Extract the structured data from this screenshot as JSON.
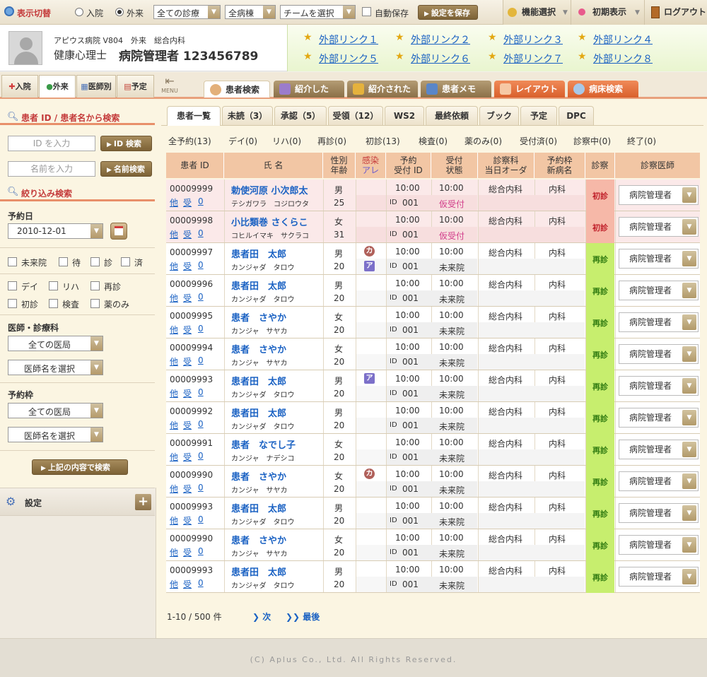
{
  "topbar": {
    "display_switch": "表示切替",
    "radio_inpatient": "入院",
    "radio_outpatient": "外来",
    "select_dept": "全ての診療",
    "select_ward": "全病棟",
    "select_team": "チームを選択",
    "autosave": "自動保存",
    "save_settings": "設定を保存",
    "feature_select": "機能選択",
    "initial_display": "初期表示",
    "logout": "ログアウト"
  },
  "header": {
    "hospital_line": "アピウス病院 V804　外来　総合内科",
    "role": "健康心理士",
    "user": "病院管理者 123456789"
  },
  "links": [
    "外部リンク１",
    "外部リンク２",
    "外部リンク３",
    "外部リンク４",
    "外部リンク５",
    "外部リンク６",
    "外部リンク７",
    "外部リンク８"
  ],
  "left_tabs": [
    "入院",
    "外来",
    "医師別",
    "予定"
  ],
  "menu_label": "MENU",
  "main_tabs": [
    "患者検索",
    "紹介した",
    "紹介された",
    "患者メモ",
    "レイアウト",
    "病床検索"
  ],
  "sidebar": {
    "search_title": "患者 ID / 患者名から検索",
    "id_placeholder": "ID を入力",
    "id_button": "ID 検索",
    "name_placeholder": "名前を入力",
    "name_button": "名前検索",
    "filter_title": "絞り込み検索",
    "date_label": "予約日",
    "date_value": "2010-12-01",
    "check_row1": [
      "未来院",
      "待",
      "診",
      "済"
    ],
    "check_row2": [
      "デイ",
      "リハ",
      "再診"
    ],
    "check_row3": [
      "初診",
      "検査",
      "薬のみ"
    ],
    "doctor_label": "医師・診療科",
    "doctor_dept": "全ての医局",
    "doctor_name": "医師名を選択",
    "slot_label": "予約枠",
    "slot_dept": "全ての医局",
    "slot_name": "医師名を選択",
    "search_button": "上記の内容で検索",
    "settings": "設定"
  },
  "sub_tabs": [
    "患者一覧",
    "未読（3）",
    "承認（5）",
    "受領（12）",
    "WS2",
    "最終依頼",
    "ブック",
    "予定",
    "DPC"
  ],
  "filters": [
    "全予約(13)",
    "デイ(0)",
    "リハ(0)",
    "再診(0)",
    "初診(13)",
    "検査(0)",
    "薬のみ(0)",
    "受付済(0)",
    "診察中(0)",
    "終了(0)"
  ],
  "table": {
    "headers": {
      "id": "患者 ID",
      "name": "氏 名",
      "sex1": "性別",
      "sex2": "年齢",
      "inf1": "感染",
      "inf2": "アレ",
      "res1": "予約",
      "res2": "受付 ID",
      "rec1": "受付",
      "rec2": "状態",
      "dept1": "診察科",
      "dept2": "当日オーダ",
      "slot1": "予約枠",
      "slot2": "新病名",
      "exam": "診察",
      "doctor": "診察医師"
    },
    "rows": [
      {
        "id": "00009999",
        "name": "勅使河原 小次郎太",
        "kana": "テシガワラ　コジロウタ",
        "sex": "男",
        "age": "25",
        "badge": "",
        "time1": "10:00",
        "rid": "001",
        "time2": "10:00",
        "status": "仮受付",
        "dept": "総合内科",
        "slot": "内科",
        "exam": "初診",
        "doctor": "病院管理者",
        "pink": true
      },
      {
        "id": "00009998",
        "name": "小比類巻 さくらこ",
        "kana": "コヒルイマキ　サクラコ",
        "sex": "女",
        "age": "31",
        "badge": "",
        "time1": "10:00",
        "rid": "001",
        "time2": "10:00",
        "status": "仮受付",
        "dept": "総合内科",
        "slot": "内科",
        "exam": "初診",
        "doctor": "病院管理者",
        "pink": true
      },
      {
        "id": "00009997",
        "name": "患者田　太郎",
        "kana": "カンジャダ　タロウ",
        "sex": "男",
        "age": "20",
        "badge": "カア",
        "time1": "10:00",
        "rid": "001",
        "time2": "10:00",
        "status": "未来院",
        "dept": "総合内科",
        "slot": "内科",
        "exam": "再診",
        "doctor": "病院管理者",
        "pink": false
      },
      {
        "id": "00009996",
        "name": "患者田　太郎",
        "kana": "カンジャダ　タロウ",
        "sex": "男",
        "age": "20",
        "badge": "",
        "time1": "10:00",
        "rid": "001",
        "time2": "10:00",
        "status": "未来院",
        "dept": "総合内科",
        "slot": "内科",
        "exam": "再診",
        "doctor": "病院管理者",
        "pink": false
      },
      {
        "id": "00009995",
        "name": "患者　さやか",
        "kana": "カンジャ　サヤカ",
        "sex": "女",
        "age": "20",
        "badge": "",
        "time1": "10:00",
        "rid": "001",
        "time2": "10:00",
        "status": "未来院",
        "dept": "総合内科",
        "slot": "内科",
        "exam": "再診",
        "doctor": "病院管理者",
        "pink": false
      },
      {
        "id": "00009994",
        "name": "患者　さやか",
        "kana": "カンジャ　サヤカ",
        "sex": "女",
        "age": "20",
        "badge": "",
        "time1": "10:00",
        "rid": "001",
        "time2": "10:00",
        "status": "未来院",
        "dept": "総合内科",
        "slot": "内科",
        "exam": "再診",
        "doctor": "病院管理者",
        "pink": false
      },
      {
        "id": "00009993",
        "name": "患者田　太郎",
        "kana": "カンジャダ　タロウ",
        "sex": "男",
        "age": "20",
        "badge": "ア",
        "time1": "10:00",
        "rid": "001",
        "time2": "10:00",
        "status": "未来院",
        "dept": "総合内科",
        "slot": "内科",
        "exam": "再診",
        "doctor": "病院管理者",
        "pink": false
      },
      {
        "id": "00009992",
        "name": "患者田　太郎",
        "kana": "カンジャダ　タロウ",
        "sex": "男",
        "age": "20",
        "badge": "",
        "time1": "10:00",
        "rid": "001",
        "time2": "10:00",
        "status": "未来院",
        "dept": "総合内科",
        "slot": "内科",
        "exam": "再診",
        "doctor": "病院管理者",
        "pink": false
      },
      {
        "id": "00009991",
        "name": "患者　なでし子",
        "kana": "カンジャ　ナデシコ",
        "sex": "女",
        "age": "20",
        "badge": "",
        "time1": "10:00",
        "rid": "001",
        "time2": "10:00",
        "status": "未来院",
        "dept": "総合内科",
        "slot": "内科",
        "exam": "再診",
        "doctor": "病院管理者",
        "pink": false
      },
      {
        "id": "00009990",
        "name": "患者　さやか",
        "kana": "カンジャ　サヤカ",
        "sex": "女",
        "age": "20",
        "badge": "カ",
        "time1": "10:00",
        "rid": "001",
        "time2": "10:00",
        "status": "未来院",
        "dept": "総合内科",
        "slot": "内科",
        "exam": "再診",
        "doctor": "病院管理者",
        "pink": false
      },
      {
        "id": "00009993",
        "name": "患者田　太郎",
        "kana": "カンジャダ　タロウ",
        "sex": "男",
        "age": "20",
        "badge": "",
        "time1": "10:00",
        "rid": "001",
        "time2": "10:00",
        "status": "未来院",
        "dept": "総合内科",
        "slot": "内科",
        "exam": "再診",
        "doctor": "病院管理者",
        "pink": false
      },
      {
        "id": "00009990",
        "name": "患者　さやか",
        "kana": "カンジャ　サヤカ",
        "sex": "女",
        "age": "20",
        "badge": "",
        "time1": "10:00",
        "rid": "001",
        "time2": "10:00",
        "status": "未来院",
        "dept": "総合内科",
        "slot": "内科",
        "exam": "再診",
        "doctor": "病院管理者",
        "pink": false
      },
      {
        "id": "00009993",
        "name": "患者田　太郎",
        "kana": "カンジャダ　タロウ",
        "sex": "男",
        "age": "20",
        "badge": "",
        "time1": "10:00",
        "rid": "001",
        "time2": "10:00",
        "status": "未来院",
        "dept": "総合内科",
        "slot": "内科",
        "exam": "再診",
        "doctor": "病院管理者",
        "pink": false
      }
    ],
    "row_links": {
      "other": "他",
      "receive": "受",
      "zero": "0",
      "id_prefix": "ID"
    }
  },
  "pagination": {
    "count": "1-10 / 500 件",
    "next": "次",
    "last": "最後"
  },
  "footer": "(C) Aplus Co., Ltd. All Rights Reserved.",
  "colors": {
    "accent": "#c43b3b",
    "link": "#1b62c3",
    "header_bg": "#f2c6a4",
    "first_visit": "#f6b8a8",
    "revisit": "#c7ee6e"
  }
}
